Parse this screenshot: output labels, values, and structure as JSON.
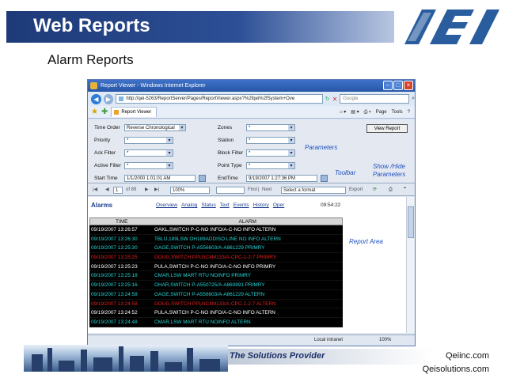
{
  "slide": {
    "title": "Web Reports",
    "subtitle": "Alarm Reports",
    "footer_tagline": "The Solutions Provider",
    "footer_link1": "Qeiinc.com",
    "footer_link2": "Qeisolutions.com"
  },
  "browser": {
    "window_title": "Report Viewer - Windows Internet Explorer",
    "address": "http://qei-5263/ReportServer/Pages/ReportViewer.aspx?%2fqei%2fSystem+Ove",
    "search_placeholder": "Google",
    "tab_label": "Report Viewer",
    "page_menu": "Page",
    "tools_menu": "Tools",
    "status_zone": "Local intranet",
    "zoom": "100%"
  },
  "params": {
    "time_order_label": "Time Order",
    "time_order_value": "Reverse Chronological",
    "priority_label": "Priority",
    "priority_value": "*",
    "ack_filter_label": "Ack Filter",
    "ack_filter_value": "*",
    "active_filter_label": "Active Filter",
    "active_filter_value": "*",
    "start_time_label": "Start Time",
    "start_time_value": "1/1/2000 1:01:01 AM",
    "zones_label": "Zones",
    "zones_value": "*",
    "station_label": "Station",
    "station_value": "*",
    "block_filter_label": "Block Filter",
    "block_filter_value": "*",
    "point_type_label": "Point Type",
    "point_type_value": "*",
    "end_time_label": "EndTime",
    "end_time_value": "9/19/2007 1:27:36 PM",
    "view_report": "View Report"
  },
  "annotations": {
    "parameters": "Parameters",
    "toolbar": "Toolbar",
    "show_hide_1": "Show /Hide",
    "show_hide_2": "Parameters",
    "report_area": "Report Area"
  },
  "toolbar": {
    "page": "1",
    "of_pages": "of 89",
    "zoom": "100%",
    "find": "Find",
    "next": "Next",
    "format": "Select a format",
    "export": "Export"
  },
  "report": {
    "heading": "Alarms",
    "links": [
      "Overview",
      "Analog",
      "Status",
      "Text",
      "Events",
      "History",
      "Oper"
    ],
    "time": "09:54:22",
    "col_time": "TIME",
    "col_alarm": "ALARM",
    "rows": [
      {
        "time": "09/19/2007 13:26:57",
        "alarm": "OAKL,SWITCH P-C-NO INFO/A-C-NO INFO ALTERN",
        "color": "#ffffff"
      },
      {
        "time": "09/19/2007 13:26:30",
        "alarm": "TBLU,189LSW OH189ADDISO LINE NO INFO ALTERN",
        "color": "#27d3d3"
      },
      {
        "time": "09/19/2007 13:25:30",
        "alarm": "GAGE,SWITCH P-A556603/A-A861229 PRIMRY",
        "color": "#27d3d3"
      },
      {
        "time": "09/19/2007 13:25:25",
        "alarm": "DOUG,SWITCH PPLNC4M133/A-CPC-1-2-7 PRIMRY",
        "color": "#e02020"
      },
      {
        "time": "09/19/2007 13:25:23",
        "alarm": "PULA,SWITCH P-C-NO INFO/A-C-NO INFO PRIMRY",
        "color": "#ffffff"
      },
      {
        "time": "09/19/2007 13:25:18",
        "alarm": "CMAR,LSW MART RTU NOINFO PRIMRY",
        "color": "#27d3d3"
      },
      {
        "time": "09/19/2007 13:25:16",
        "alarm": "OHAR,SWITCH P-A550725/A-A860891 PRIMRY",
        "color": "#27d3d3"
      },
      {
        "time": "09/19/2007 13:24:58",
        "alarm": "GAGE,SWITCH P-A556603/A-A861229 ALTERN",
        "color": "#27d3d3"
      },
      {
        "time": "09/19/2007 13:24:58",
        "alarm": "DOUG,SWITCH PPLNC4M133/A-CPC-1-2-7 ALTERN",
        "color": "#e02020"
      },
      {
        "time": "09/19/2007 13:24:52",
        "alarm": "PULA,SWITCH P-C-NO INFO/A-C-NO INFO ALTERN",
        "color": "#ffffff"
      },
      {
        "time": "09/19/2007 13:24:48",
        "alarm": "CMAR,LSW MART RTU NOINFO ALTERN",
        "color": "#27d3d3"
      }
    ]
  }
}
